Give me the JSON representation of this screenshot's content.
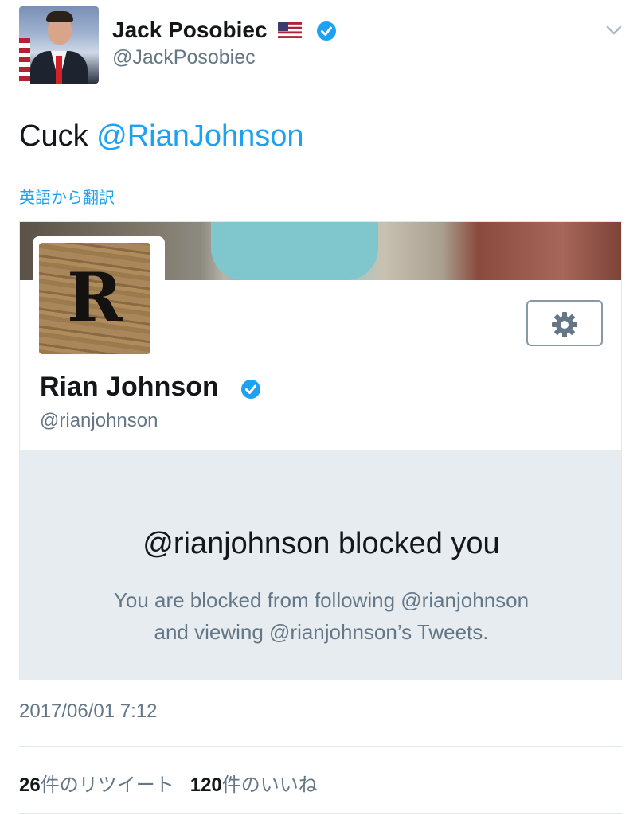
{
  "author": {
    "name": "Jack Posobiec",
    "handle": "@JackPosobiec",
    "flag_icon": "us-flag-icon",
    "verified_icon": "verified-badge-icon"
  },
  "tweet": {
    "text_prefix": "Cuck ",
    "mention": "@RianJohnson",
    "translate_link": "英語から翻訳"
  },
  "card": {
    "profile_letter": "R",
    "name": "Rian Johnson",
    "handle": "@rianjohnson",
    "settings_icon": "gear-icon",
    "blocked_title": "@rianjohnson blocked you",
    "blocked_line1": "You are blocked from following @rianjohnson",
    "blocked_line2": "and viewing @rianjohnson’s Tweets."
  },
  "footer": {
    "timestamp": "2017/06/01 7:12",
    "retweet_count": "26",
    "retweet_label": "件のリツイート",
    "like_count": "120",
    "like_label": "件のいいね"
  },
  "colors": {
    "link": "#1da1f2",
    "secondary_text": "#657786",
    "blocked_bg": "#e6ecf0"
  }
}
